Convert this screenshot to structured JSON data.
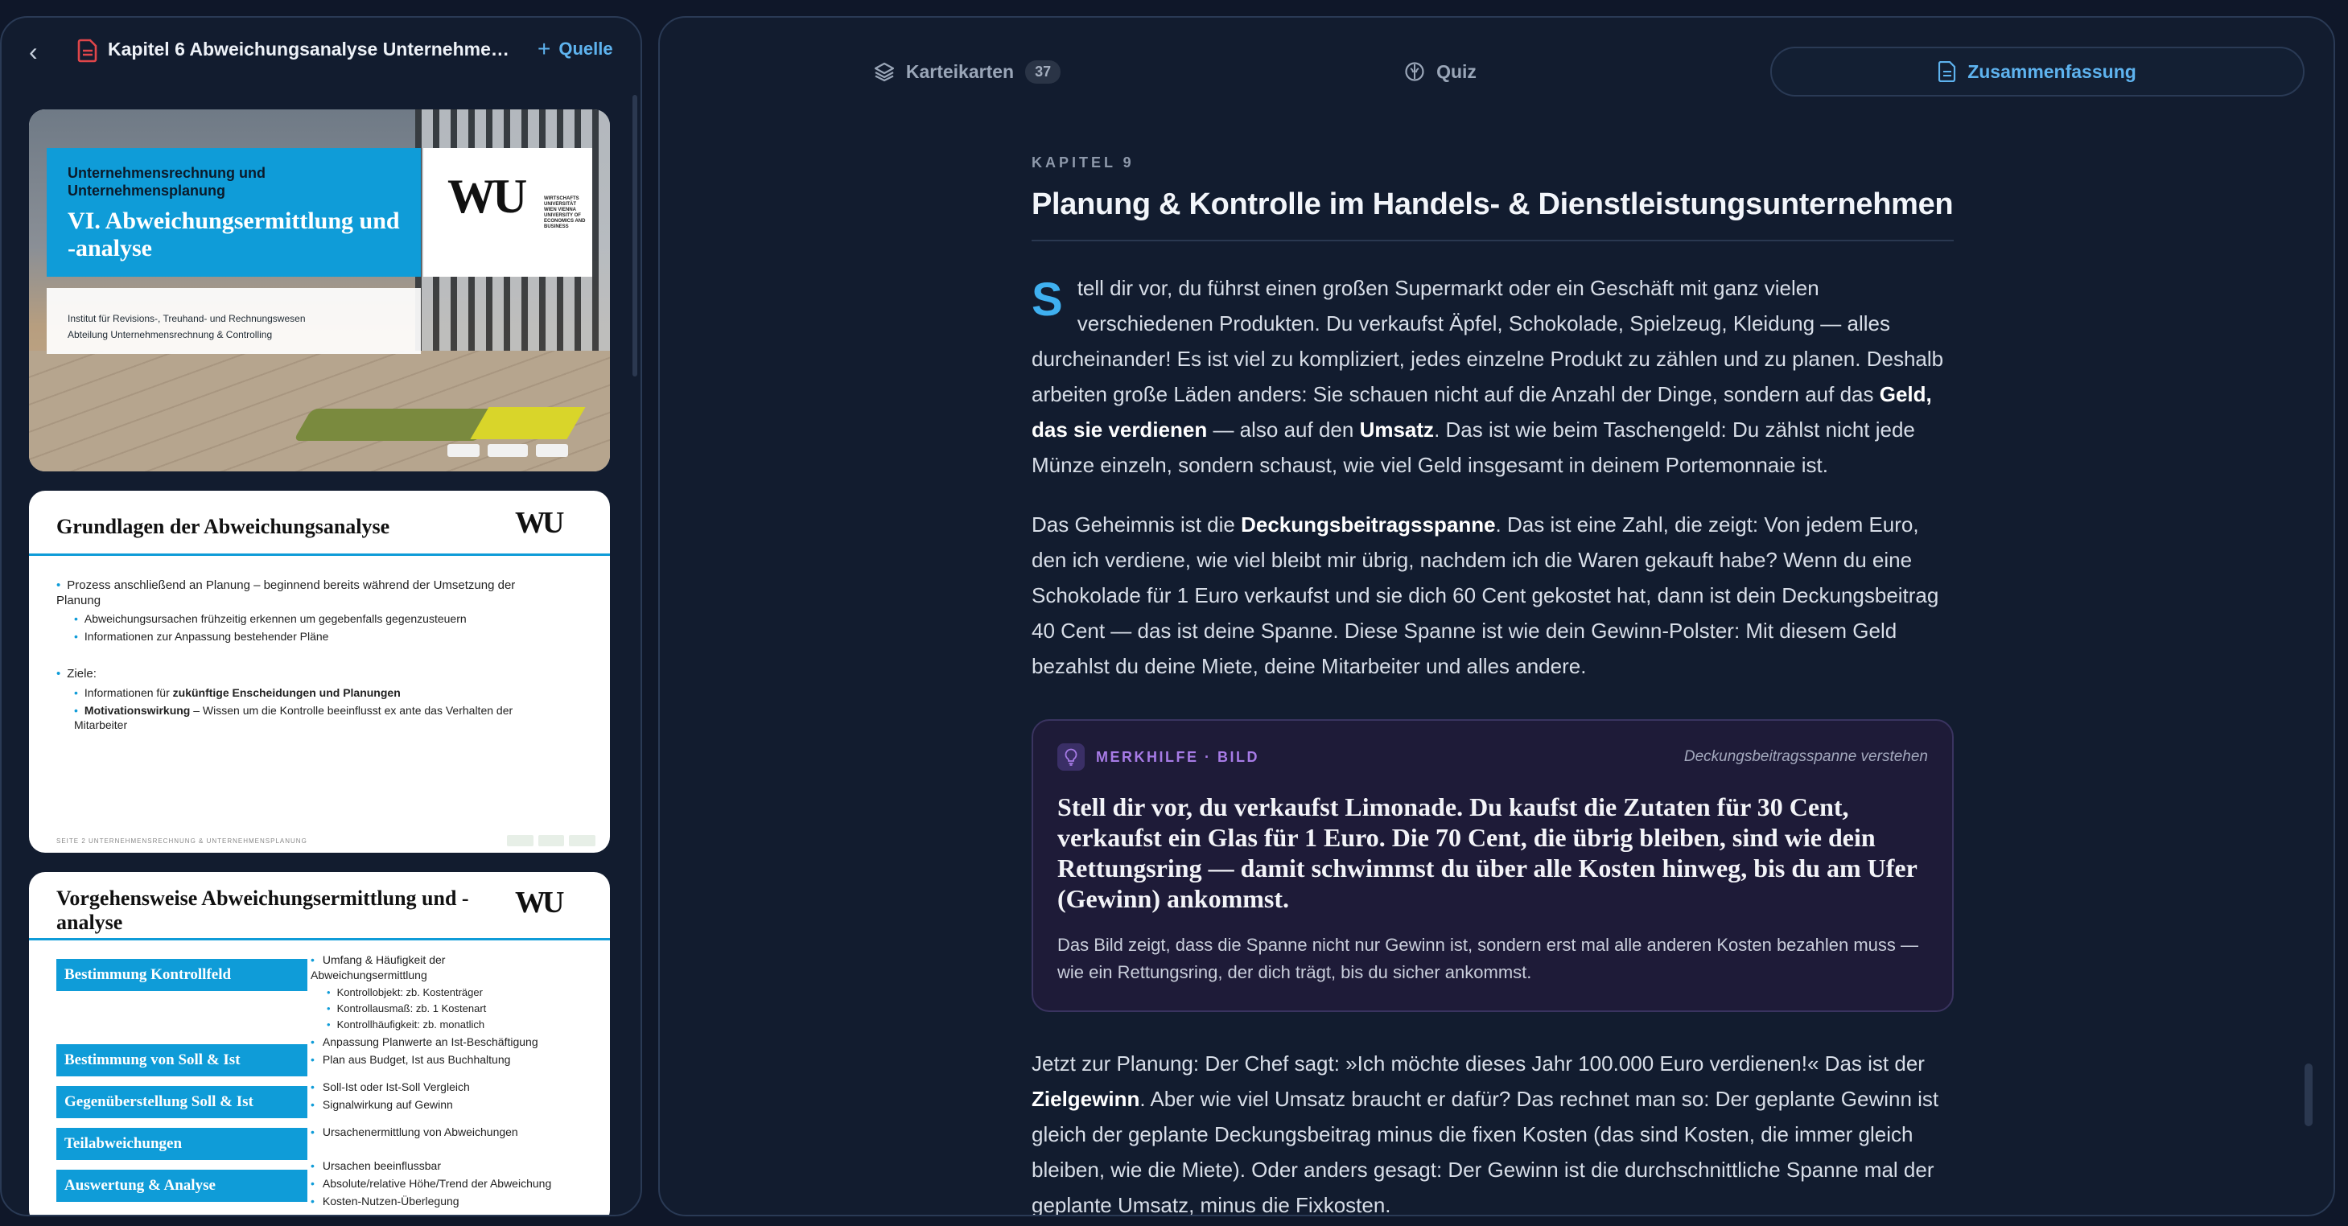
{
  "source_panel": {
    "back_label": "‹",
    "title": "Kapitel 6 Abweichungsanalyse Unternehmen...",
    "add_source_label": "Quelle"
  },
  "slides": {
    "s1": {
      "course": "Unternehmensrechnung und Unternehmensplanung",
      "title": "VI. Abweichungsermittlung und -analyse",
      "institute": "Institut für Revisions-, Treuhand- und Rechnungswesen",
      "department": "Abteilung Unternehmensrechnung & Controlling",
      "logo_text": "WU",
      "logo_sub": "WIRTSCHAFTS UNIVERSITÄT WIEN VIENNA UNIVERSITY OF ECONOMICS AND BUSINESS"
    },
    "s2": {
      "title": "Grundlagen der Abweichungsanalyse",
      "b1": "Prozess anschließend an Planung – beginnend bereits während der Umsetzung der Planung",
      "b1a": "Abweichungsursachen frühzeitig erkennen um gegebenfalls gegenzusteuern",
      "b1b": "Informationen zur Anpassung bestehender Pläne",
      "b2": "Ziele:",
      "b2a_pre": "Informationen für ",
      "b2a_bold": "zukünftige Enscheidungen und Planungen",
      "b2b_bold": "Motivationswirkung",
      "b2b_rest": " – Wissen um die Kontrolle beeinflusst ex ante das Verhalten der Mitarbeiter",
      "footer": "SEITE 2        UNTERNEHMENSRECHNUNG & UNTERNEHMENSPLANUNG"
    },
    "s3": {
      "title": "Vorgehensweise Abweichungsermittlung und -analyse",
      "steps": [
        "Bestimmung Kontrollfeld",
        "Bestimmung von Soll & Ist",
        "Gegenüberstellung Soll & Ist",
        "Teilabweichungen",
        "Auswertung & Analyse"
      ],
      "items": {
        "a": "Umfang & Häufigkeit der Abweichungsermittlung",
        "a1": "Kontrollobjekt: zb. Kostenträger",
        "a2": "Kontrollausmaß: zb. 1 Kostenart",
        "a3": "Kontrollhäufigkeit: zb. monatlich",
        "b": "Anpassung Planwerte an Ist-Beschäftigung",
        "c": "Plan aus Budget, Ist aus Buchhaltung",
        "d": "Soll-Ist oder Ist-Soll Vergleich",
        "e": "Signalwirkung auf Gewinn",
        "f": "Ursachenermittlung von Abweichungen",
        "g": "Ursachen beeinflussbar",
        "h": "Absolute/relative Höhe/Trend der Abweichung",
        "i": "Kosten-Nutzen-Überlegung"
      }
    }
  },
  "tabs": {
    "cards_label": "Karteikarten",
    "cards_count": "37",
    "quiz_label": "Quiz",
    "summary_label": "Zusammenfassung"
  },
  "summary": {
    "chapter": "KAPITEL 9",
    "title": "Planung & Kontrolle im Handels- & Dienstleistungsunternehmen",
    "p1": {
      "dropcap": "S",
      "t1": "tell dir vor, du führst einen großen Supermarkt oder ein Geschäft mit ganz vielen verschiedenen Produkten. Du verkaufst Äpfel, Schokolade, Spielzeug, Kleidung — alles durcheinander! Es ist viel zu kompliziert, jedes einzelne Produkt zu zählen und zu planen. Deshalb arbeiten große Läden anders: Sie schauen nicht auf die Anzahl der Dinge, sondern auf das ",
      "b1": "Geld, das sie verdienen",
      "t2": " — also auf den ",
      "b2": "Umsatz",
      "t3": ". Das ist wie beim Taschengeld: Du zählst nicht jede Münze einzeln, sondern schaust, wie viel Geld insgesamt in deinem Portemonnaie ist."
    },
    "p2": {
      "t1": "Das Geheimnis ist die ",
      "b1": "Deckungsbeitragsspanne",
      "t2": ". Das ist eine Zahl, die zeigt: Von jedem Euro, den ich verdiene, wie viel bleibt mir übrig, nachdem ich die Waren gekauft habe? Wenn du eine Schokolade für 1 Euro verkaufst und sie dich 60 Cent gekostet hat, dann ist dein Deckungsbeitrag 40 Cent — das ist deine Spanne. Diese Spanne ist wie dein Gewinn-Polster: Mit diesem Geld bezahlst du deine Miete, deine Mitarbeiter und alles andere."
    },
    "merkhilfe": {
      "label": "MERKHILFE · BILD",
      "topic": "Deckungsbeitragsspanne verstehen",
      "quote": "Stell dir vor, du verkaufst Limonade. Du kaufst die Zutaten für 30 Cent, verkaufst ein Glas für 1 Euro. Die 70 Cent, die übrig bleiben, sind wie dein Rettungsring — damit schwimmst du über alle Kosten hinweg, bis du am Ufer (Gewinn) ankommst.",
      "explanation": "Das Bild zeigt, dass die Spanne nicht nur Gewinn ist, sondern erst mal alle anderen Kosten bezahlen muss — wie ein Rettungsring, der dich trägt, bis du sicher ankommst."
    },
    "p3": {
      "t1": "Jetzt zur Planung: Der Chef sagt: »Ich möchte dieses Jahr 100.000 Euro verdienen!« Das ist der ",
      "b1": "Zielgewinn",
      "t2": ". Aber wie viel Umsatz braucht er dafür? Das rechnet man so: Der geplante Gewinn ist gleich der geplante Deckungsbeitrag minus die fixen Kosten (das sind Kosten, die immer gleich bleiben, wie die Miete). Oder anders gesagt: Der Gewinn ist die durchschnittliche Spanne mal der geplante Umsatz, minus die Fixkosten."
    }
  },
  "colors": {
    "accent": "#5eb3ef",
    "background": "#0f1729",
    "merkhilfe_accent": "#a77be6",
    "slide_blue": "#0f9cd8"
  }
}
